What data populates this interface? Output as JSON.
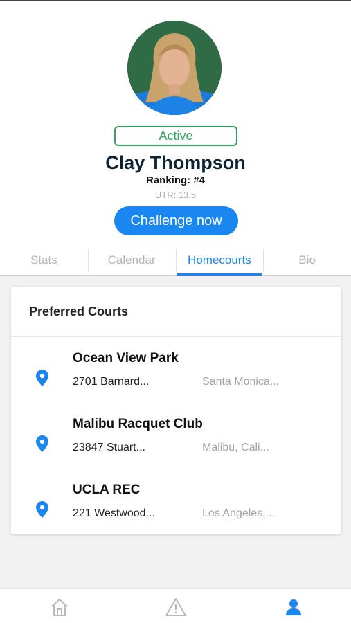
{
  "profile": {
    "status": "Active",
    "name": "Clay Thompson",
    "ranking": "Ranking: #4",
    "utr": "UTR: 13.5",
    "challenge_label": "Challenge now"
  },
  "tabs": [
    {
      "label": "Stats"
    },
    {
      "label": "Calendar"
    },
    {
      "label": "Homecourts"
    },
    {
      "label": "Bio"
    }
  ],
  "active_tab": "Homecourts",
  "courts": {
    "title": "Preferred Courts",
    "items": [
      {
        "name": "Ocean View Park",
        "address": "2701 Barnard...",
        "city": "Santa Monica..."
      },
      {
        "name": "Malibu Racquet Club",
        "address": "23847 Stuart...",
        "city": "Malibu, Cali..."
      },
      {
        "name": "UCLA REC",
        "address": "221 Westwood...",
        "city": "Los Angeles,..."
      }
    ]
  },
  "bottom_nav": [
    {
      "icon": "home-icon"
    },
    {
      "icon": "warning-icon"
    },
    {
      "icon": "user-icon"
    }
  ],
  "colors": {
    "accent": "#1a86f0",
    "status_green": "#2ea85a",
    "name_color": "#0f2433"
  }
}
